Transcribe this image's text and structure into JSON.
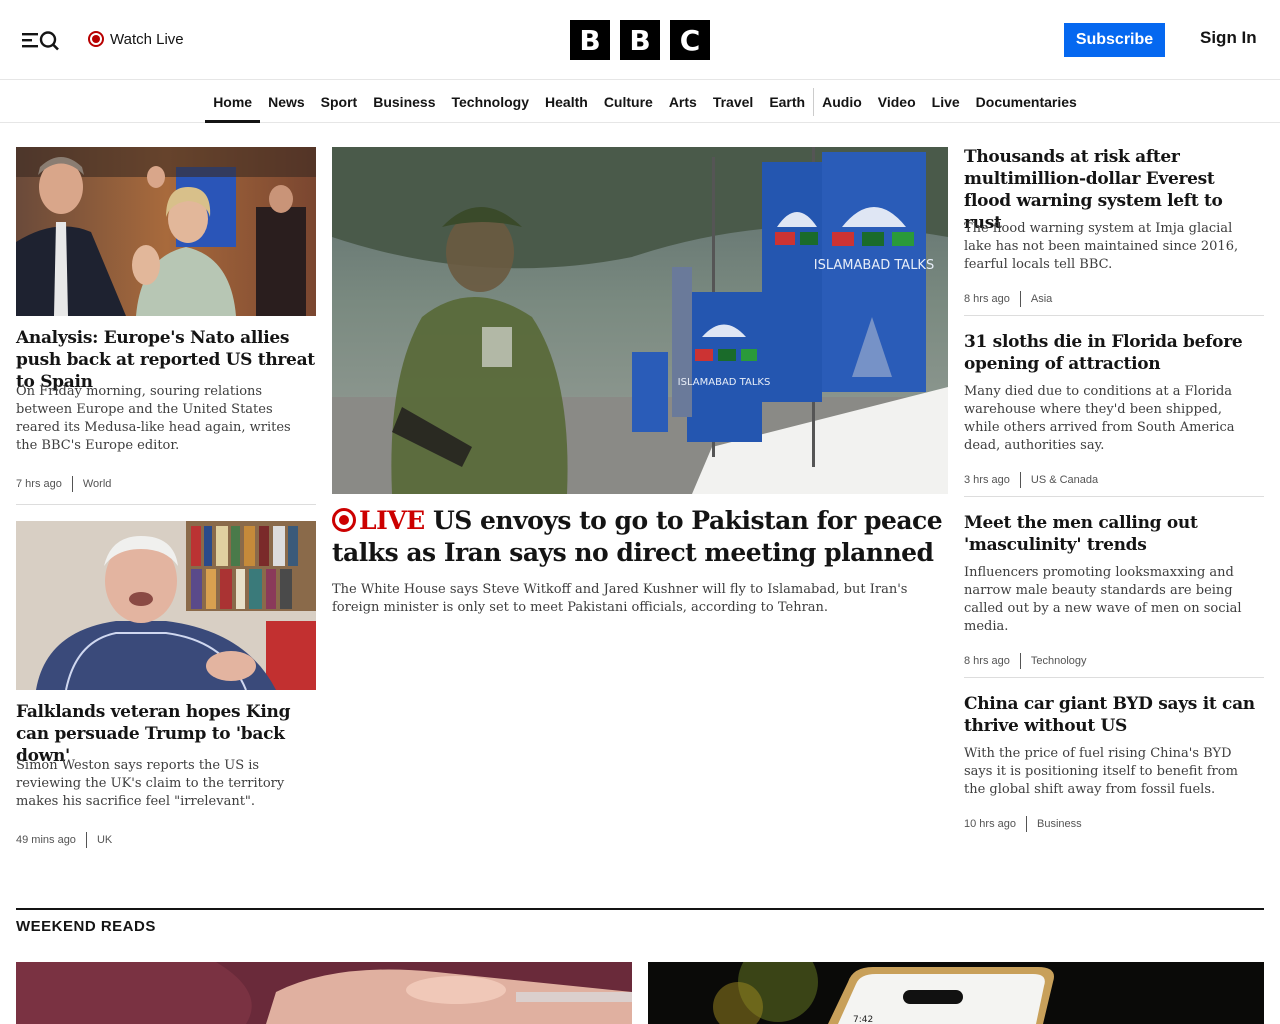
{
  "header": {
    "watch_live": "Watch Live",
    "logo_letters": [
      "B",
      "B",
      "C"
    ],
    "subscribe": "Subscribe",
    "sign_in": "Sign In"
  },
  "nav": {
    "items": [
      "Home",
      "News",
      "Sport",
      "Business",
      "Technology",
      "Health",
      "Culture",
      "Arts",
      "Travel",
      "Earth",
      "Audio",
      "Video",
      "Live",
      "Documentaries"
    ],
    "active": "Home"
  },
  "left": [
    {
      "headline": "Analysis: Europe's Nato allies push back at reported US threat to Spain",
      "summary": "On Friday morning, souring relations between Europe and the United States reared its Medusa-like head again, writes the BBC's Europe editor.",
      "time": "7 hrs ago",
      "section": "World"
    },
    {
      "headline": "Falklands veteran hopes King can persuade Trump to 'back down'",
      "summary": "Simon Weston says reports the US is reviewing the UK's claim to the territory makes his sacrifice feel \"irrelevant\".",
      "time": "49 mins ago",
      "section": "UK"
    }
  ],
  "main": {
    "live_label": "LIVE",
    "headline": "US envoys to go to Pakistan for peace talks as Iran says no direct meeting planned",
    "summary": "The White House says Steve Witkoff and Jared Kushner will fly to Islamabad, but Iran's foreign minister is only set to meet Pakistani officials, according to Tehran.",
    "banner_text": "ISLAMABAD TALKS"
  },
  "right": [
    {
      "headline": "Thousands at risk after multimillion-dollar Everest flood warning system left to rust",
      "summary": "The flood warning system at Imja glacial lake has not been maintained since 2016, fearful locals tell BBC.",
      "time": "8 hrs ago",
      "section": "Asia"
    },
    {
      "headline": "31 sloths die in Florida before opening of attraction",
      "summary": "Many died due to conditions at a Florida warehouse where they'd been shipped, while others arrived from South America dead, authorities say.",
      "time": "3 hrs ago",
      "section": "US & Canada"
    },
    {
      "headline": "Meet the men calling out 'masculinity' trends",
      "summary": "Influencers promoting looksmaxxing and narrow male beauty standards are being called out by a new wave of men on social media.",
      "time": "8 hrs ago",
      "section": "Technology"
    },
    {
      "headline": "China car giant BYD says it can thrive without US",
      "summary": "With the price of fuel rising China's BYD says it is positioning itself to benefit from the global shift away from fossil fuels.",
      "time": "10 hrs ago",
      "section": "Business"
    }
  ],
  "weekend": {
    "title": "WEEKEND READS",
    "phone_time": "7:42"
  }
}
